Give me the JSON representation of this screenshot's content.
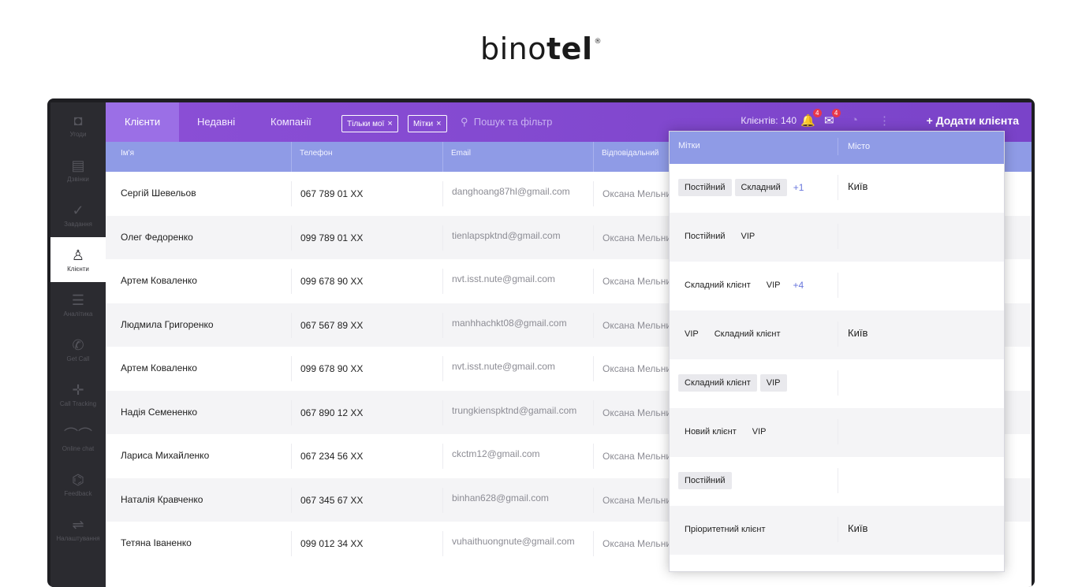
{
  "logo": {
    "light": "bino",
    "bold": "tel",
    "mark": "®"
  },
  "sidebar": {
    "items": [
      {
        "icon": "deals-icon",
        "glyph": "◘",
        "label": "Угоди",
        "active": false
      },
      {
        "icon": "calls-icon",
        "glyph": "▤",
        "label": "Дзвінки",
        "active": false
      },
      {
        "icon": "checkmark-icon",
        "glyph": "✓",
        "label": "Завдання",
        "active": false
      },
      {
        "icon": "user-icon",
        "glyph": "♙",
        "label": "Клієнти",
        "active": true
      },
      {
        "icon": "analytics-icon",
        "glyph": "☰",
        "label": "Аналітика",
        "active": false
      },
      {
        "icon": "get-call-icon",
        "glyph": "✆",
        "label": "Get Call",
        "active": false
      },
      {
        "icon": "call-tracking-icon",
        "glyph": "✛",
        "label": "Call Tracking",
        "active": false
      },
      {
        "icon": "online-chat-icon",
        "glyph": "⌒⌒",
        "label": "Online chat",
        "active": false
      },
      {
        "icon": "feedback-icon",
        "glyph": "⌬",
        "label": "Feedback",
        "active": false
      },
      {
        "icon": "settings-icon",
        "glyph": "⇌",
        "label": "Налаштування",
        "active": false
      }
    ]
  },
  "topbar": {
    "tabs": [
      "Клієнти",
      "Недавні",
      "Компанії"
    ],
    "filter_chips": [
      "Тільки мої",
      "Мітки"
    ],
    "search_placeholder": "Пошук та фільтр",
    "clients_count": "Клієнтів: 140",
    "notifications_badge": "4",
    "messages_badge": "4",
    "add_button": "+ Додати клієнта"
  },
  "table": {
    "columns": [
      "Ім'я",
      "Телефон",
      "Email",
      "Відповідальний"
    ],
    "rows": [
      {
        "name": "Сергій Шевельов",
        "phone": "067 789 01 XX",
        "email": "danghoang87hl@gmail.com",
        "responsible": "Оксана Мельник"
      },
      {
        "name": "Олег Федоренко",
        "phone": "099 789 01 XX",
        "email": "tienlapspktnd@gmail.com",
        "responsible": "Оксана Мельник"
      },
      {
        "name": "Артем Коваленко",
        "phone": "099 678 90 XX",
        "email": "nvt.isst.nute@gmail.com",
        "responsible": "Оксана Мельник"
      },
      {
        "name": "Людмила Григоренко",
        "phone": "067 567 89 XX",
        "email": "manhhachkt08@gmail.com",
        "responsible": "Оксана Мельник"
      },
      {
        "name": "Артем Коваленко",
        "phone": "099 678 90 XX",
        "email": "nvt.isst.nute@gmail.com",
        "responsible": "Оксана Мельник"
      },
      {
        "name": "Надія Семененко",
        "phone": "067 890 12 XX",
        "email": "trungkienspktnd@gamail.com",
        "responsible": "Оксана Мельник"
      },
      {
        "name": "Лариса Михайленко",
        "phone": "067 234 56 XX",
        "email": "ckctm12@gmail.com",
        "responsible": "Оксана Мельник"
      },
      {
        "name": "Наталія Кравченко",
        "phone": "067 345 67 XX",
        "email": "binhan628@gmail.com",
        "responsible": "Оксана Мельник"
      },
      {
        "name": "Тетяна Іваненко",
        "phone": "099 012 34 XX",
        "email": "vuhaithuongnute@gmail.com",
        "responsible": "Оксана Мельник"
      }
    ]
  },
  "popup": {
    "columns": [
      "Мітки",
      "Місто"
    ],
    "rows": [
      {
        "tags": [
          {
            "label": "Постійний",
            "bg": true
          },
          {
            "label": "Складний",
            "bg": true
          }
        ],
        "more": "+1",
        "city": "Київ"
      },
      {
        "tags": [
          {
            "label": "Постійний",
            "bg": false
          },
          {
            "label": "VIP",
            "bg": false
          }
        ],
        "more": "",
        "city": ""
      },
      {
        "tags": [
          {
            "label": "Складний клієнт",
            "bg": false
          },
          {
            "label": "VIP",
            "bg": false
          }
        ],
        "more": "+4",
        "city": ""
      },
      {
        "tags": [
          {
            "label": "VIP",
            "bg": false
          },
          {
            "label": "Складний клієнт",
            "bg": false
          }
        ],
        "more": "",
        "city": "Київ"
      },
      {
        "tags": [
          {
            "label": "Складний клієнт",
            "bg": true
          },
          {
            "label": "VIP",
            "bg": true
          }
        ],
        "more": "",
        "city": ""
      },
      {
        "tags": [
          {
            "label": "Новий клієнт",
            "bg": false
          },
          {
            "label": "VIP",
            "bg": false
          }
        ],
        "more": "",
        "city": ""
      },
      {
        "tags": [
          {
            "label": "Постійний",
            "bg": true
          }
        ],
        "more": "",
        "city": ""
      },
      {
        "tags": [
          {
            "label": "Пріоритетний клієнт",
            "bg": false
          }
        ],
        "more": "",
        "city": "Київ"
      }
    ]
  },
  "colors": {
    "accent": "#8b4fd6",
    "header": "#8f9be6",
    "badge": "#e8374b",
    "more_link": "#6876dc"
  }
}
